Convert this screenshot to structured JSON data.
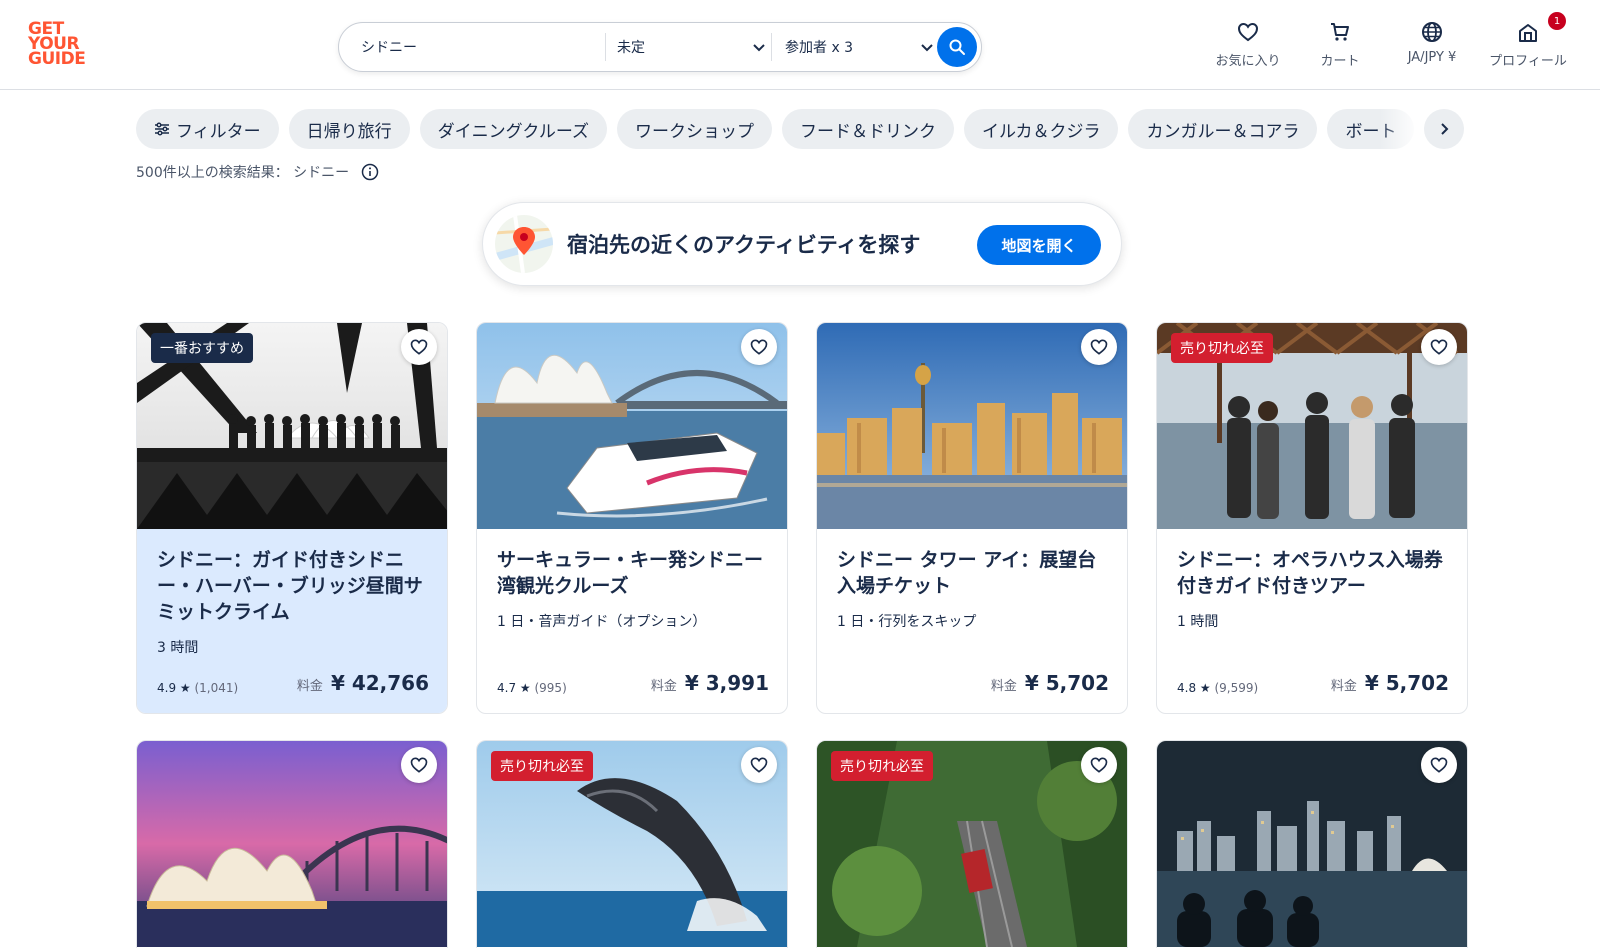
{
  "brand": {
    "logo_lines": [
      "GET",
      "YOUR",
      "GUIDE"
    ],
    "color": "#ff5533"
  },
  "search": {
    "destination": "シドニー",
    "date": "未定",
    "guests": "参加者 x 3"
  },
  "header_nav": [
    {
      "label": "お気に入り",
      "icon": "heart-icon"
    },
    {
      "label": "カート",
      "icon": "cart-icon"
    },
    {
      "label": "JA/JPY ¥",
      "icon": "globe-icon"
    },
    {
      "label": "プロフィール",
      "icon": "profile-icon",
      "badge": "1"
    }
  ],
  "chips": [
    "フィルター",
    "日帰り旅行",
    "ダイニングクルーズ",
    "ワークショップ",
    "フード＆ドリンク",
    "イルカ＆クジラ",
    "カンガルー＆コアラ",
    "ボート"
  ],
  "results": {
    "text": "500件以上の検索結果： シドニー"
  },
  "map_banner": {
    "title": "宿泊先の近くのアクティビティを探す",
    "button": "地図を開く"
  },
  "colors": {
    "accent": "#0071eb",
    "tag_red": "#d31f2f",
    "tag_dark": "#1a2b49",
    "featured_bg": "#dbeafe"
  },
  "cards": [
    {
      "tag": "一番おすすめ",
      "title": "シドニー：ガイド付きシドニー・ハーバー・ブリッジ昼間サミットクライム",
      "meta": "3 時間",
      "rating": "4.9 ★",
      "reviews": "(1,041)",
      "price_label": "料金",
      "price": "¥ 42,766"
    },
    {
      "tag": "",
      "title": "サーキュラー・キー発シドニー湾観光クルーズ",
      "meta": "1 日・音声ガイド（オプション）",
      "rating": "4.7 ★",
      "reviews": "(995)",
      "price_label": "料金",
      "price": "¥ 3,991"
    },
    {
      "tag": "",
      "title": "シドニー タワー アイ：展望台入場チケット",
      "meta": "1 日・行列をスキップ",
      "rating": "",
      "reviews": "",
      "price_label": "料金",
      "price": "¥ 5,702"
    },
    {
      "tag": "売り切れ必至",
      "title": "シドニー：オペラハウス入場券付きガイド付きツアー",
      "meta": "1 時間",
      "rating": "4.8 ★",
      "reviews": "(9,599)",
      "price_label": "料金",
      "price": "¥ 5,702"
    },
    {
      "tag": ""
    },
    {
      "tag": "売り切れ必至"
    },
    {
      "tag": "売り切れ必至"
    },
    {
      "tag": ""
    }
  ]
}
